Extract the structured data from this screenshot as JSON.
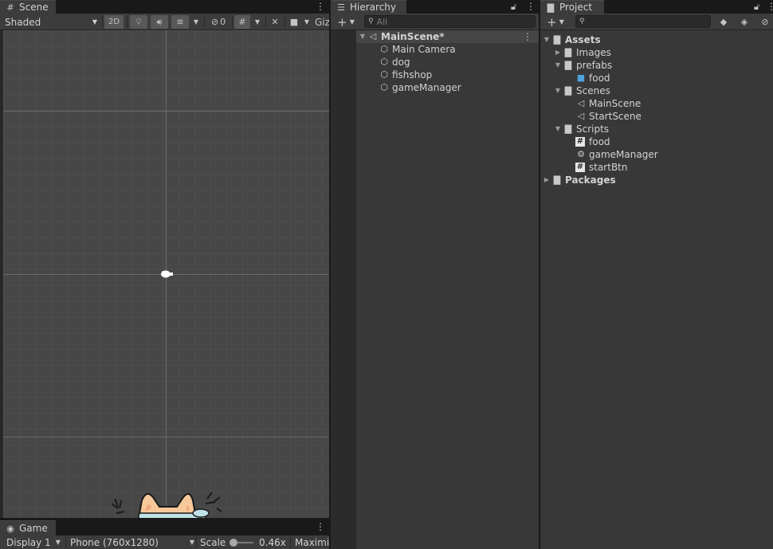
{
  "scene": {
    "tab_label": "Scene",
    "draw_mode": "Shaded",
    "mode_2d": "2D",
    "hidden_count": "0",
    "gizmos_label": "Giz"
  },
  "game": {
    "tab_label": "Game",
    "display": "Display 1",
    "resolution": "Phone (760x1280)",
    "scale_label": "Scale",
    "scale_value": "0.46x",
    "maximize": "Maximiz"
  },
  "hierarchy": {
    "tab_label": "Hierarchy",
    "search_placeholder": "All",
    "scene_name": "MainScene*",
    "objects": [
      "Main Camera",
      "dog",
      "fishshop",
      "gameManager"
    ]
  },
  "project": {
    "tab_label": "Project",
    "assets": "Assets",
    "images": "Images",
    "prefabs": "prefabs",
    "prefab_food": "food",
    "scenes": "Scenes",
    "scene_main": "MainScene",
    "scene_start": "StartScene",
    "scripts": "Scripts",
    "script_food": "food",
    "script_gamemanager": "gameManager",
    "script_startbtn": "startBtn",
    "packages": "Packages"
  },
  "colors": {
    "accent": "#4fa3e0",
    "cat": "#f7c99a",
    "panel": "#383838"
  }
}
